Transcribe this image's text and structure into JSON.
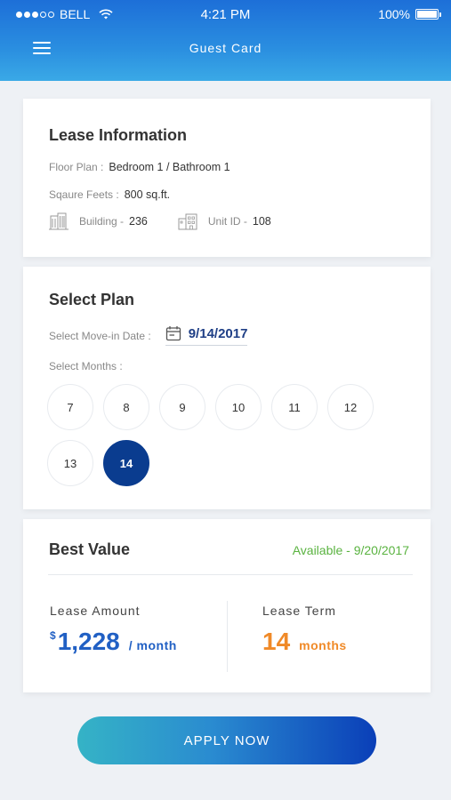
{
  "status_bar": {
    "carrier": "BELL",
    "time": "4:21 PM",
    "battery": "100%"
  },
  "nav": {
    "title": "Guest Card"
  },
  "lease_info": {
    "title": "Lease Information",
    "floor_plan_label": "Floor Plan :",
    "floor_plan_value": "Bedroom 1 / Bathroom 1",
    "square_feet_label": "Sqaure Feets :",
    "square_feet_value": "800 sq.ft.",
    "building_label": "Building -",
    "building_value": "236",
    "unit_label": "Unit ID -",
    "unit_value": "108"
  },
  "select_plan": {
    "title": "Select Plan",
    "move_in_label": "Select Move-in Date :",
    "move_in_date": "9/14/2017",
    "months_label": "Select Months :",
    "months": [
      "7",
      "8",
      "9",
      "10",
      "11",
      "12",
      "13",
      "14"
    ],
    "selected_month": "14"
  },
  "best_value": {
    "title": "Best Value",
    "available": "Available - 9/20/2017",
    "lease_amount_label": "Lease Amount",
    "currency_symbol": "$",
    "lease_amount": "1,228",
    "lease_amount_unit": "/ month",
    "lease_term_label": "Lease Term",
    "lease_term": "14",
    "lease_term_unit": "months"
  },
  "apply_button": "APPLY NOW",
  "colors": {
    "header_gradient_start": "#1d6fd8",
    "selected_month": "#0a3c8f",
    "available_green": "#5ab340",
    "amount_blue": "#2160c4",
    "term_orange": "#f08a28"
  },
  "icons": {
    "menu": "hamburger-menu-icon",
    "building": "building-icon",
    "unit": "unit-building-icon",
    "calendar": "calendar-icon",
    "wifi": "wifi-icon",
    "battery": "battery-icon"
  }
}
